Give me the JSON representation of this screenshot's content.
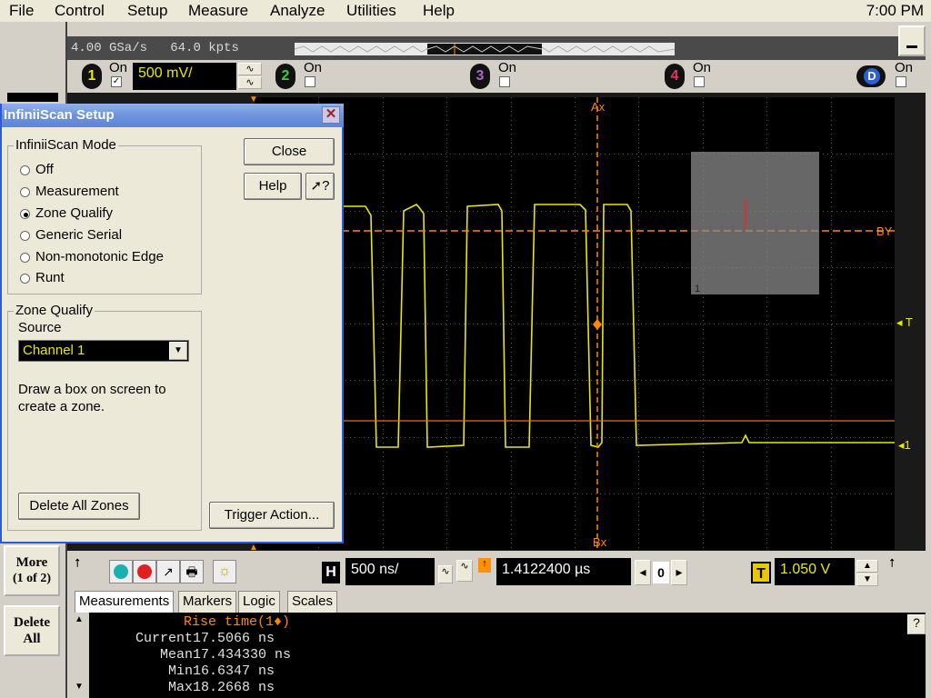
{
  "menu": {
    "items": [
      "File",
      "Control",
      "Setup",
      "Measure",
      "Analyze",
      "Utilities",
      "Help"
    ],
    "clock": "7:00 PM"
  },
  "acquisition": {
    "sample_rate": "4.00 GSa/s",
    "memory": "64.0 kpts"
  },
  "channels": {
    "ch1": {
      "number": "1",
      "on_label": "On",
      "checked": true,
      "scale": "500 mV/",
      "color": "#e8e800"
    },
    "ch2": {
      "number": "2",
      "on_label": "On",
      "checked": false,
      "color": "#3bd13b"
    },
    "ch3": {
      "number": "3",
      "on_label": "On",
      "checked": false,
      "color": "#b45fd8"
    },
    "ch4": {
      "number": "4",
      "on_label": "On",
      "checked": false,
      "color": "#e83060"
    },
    "digital": {
      "label": "D",
      "on_label": "On",
      "checked": false
    }
  },
  "markers": {
    "ax": "Ax",
    "bx": "Bx",
    "by": "BY",
    "trigger": "T",
    "ch_ref": "1",
    "zone_number": "1"
  },
  "dialog": {
    "title": "InfiniiScan Setup",
    "close_label": "Close",
    "help_label": "Help",
    "whats_this_label": "?",
    "mode_group": "InfiniiScan Mode",
    "modes": [
      {
        "label": "Off",
        "selected": false
      },
      {
        "label": "Measurement",
        "selected": false
      },
      {
        "label": "Zone Qualify",
        "selected": true
      },
      {
        "label": "Generic Serial",
        "selected": false
      },
      {
        "label": "Non-monotonic Edge",
        "selected": false
      },
      {
        "label": "Runt",
        "selected": false
      }
    ],
    "zone_group": "Zone Qualify",
    "source_label": "Source",
    "source_value": "Channel 1",
    "instructions": "Draw a box on screen to create a zone.",
    "delete_zones_label": "Delete All Zones",
    "trigger_action_label": "Trigger Action..."
  },
  "side_buttons": {
    "more_line1": "More",
    "more_line2": "(1 of 2)",
    "delete_line1": "Delete",
    "delete_line2": "All"
  },
  "horizontal": {
    "badge": "H",
    "scale": "500 ns/",
    "position": "1.4122400 µs",
    "delay_value": "0"
  },
  "trigger": {
    "badge": "T",
    "level": "1.050 V"
  },
  "tabs": [
    "Measurements",
    "Markers",
    "Logic",
    "Scales"
  ],
  "measurement": {
    "title": "Rise time(1♦)",
    "rows": [
      {
        "label": "Current",
        "value": "17.5066 ns"
      },
      {
        "label": "Mean",
        "value": "17.434330 ns"
      },
      {
        "label": "Min",
        "value": "16.6347 ns"
      },
      {
        "label": "Max",
        "value": "18.2668 ns"
      }
    ],
    "help": "?"
  }
}
